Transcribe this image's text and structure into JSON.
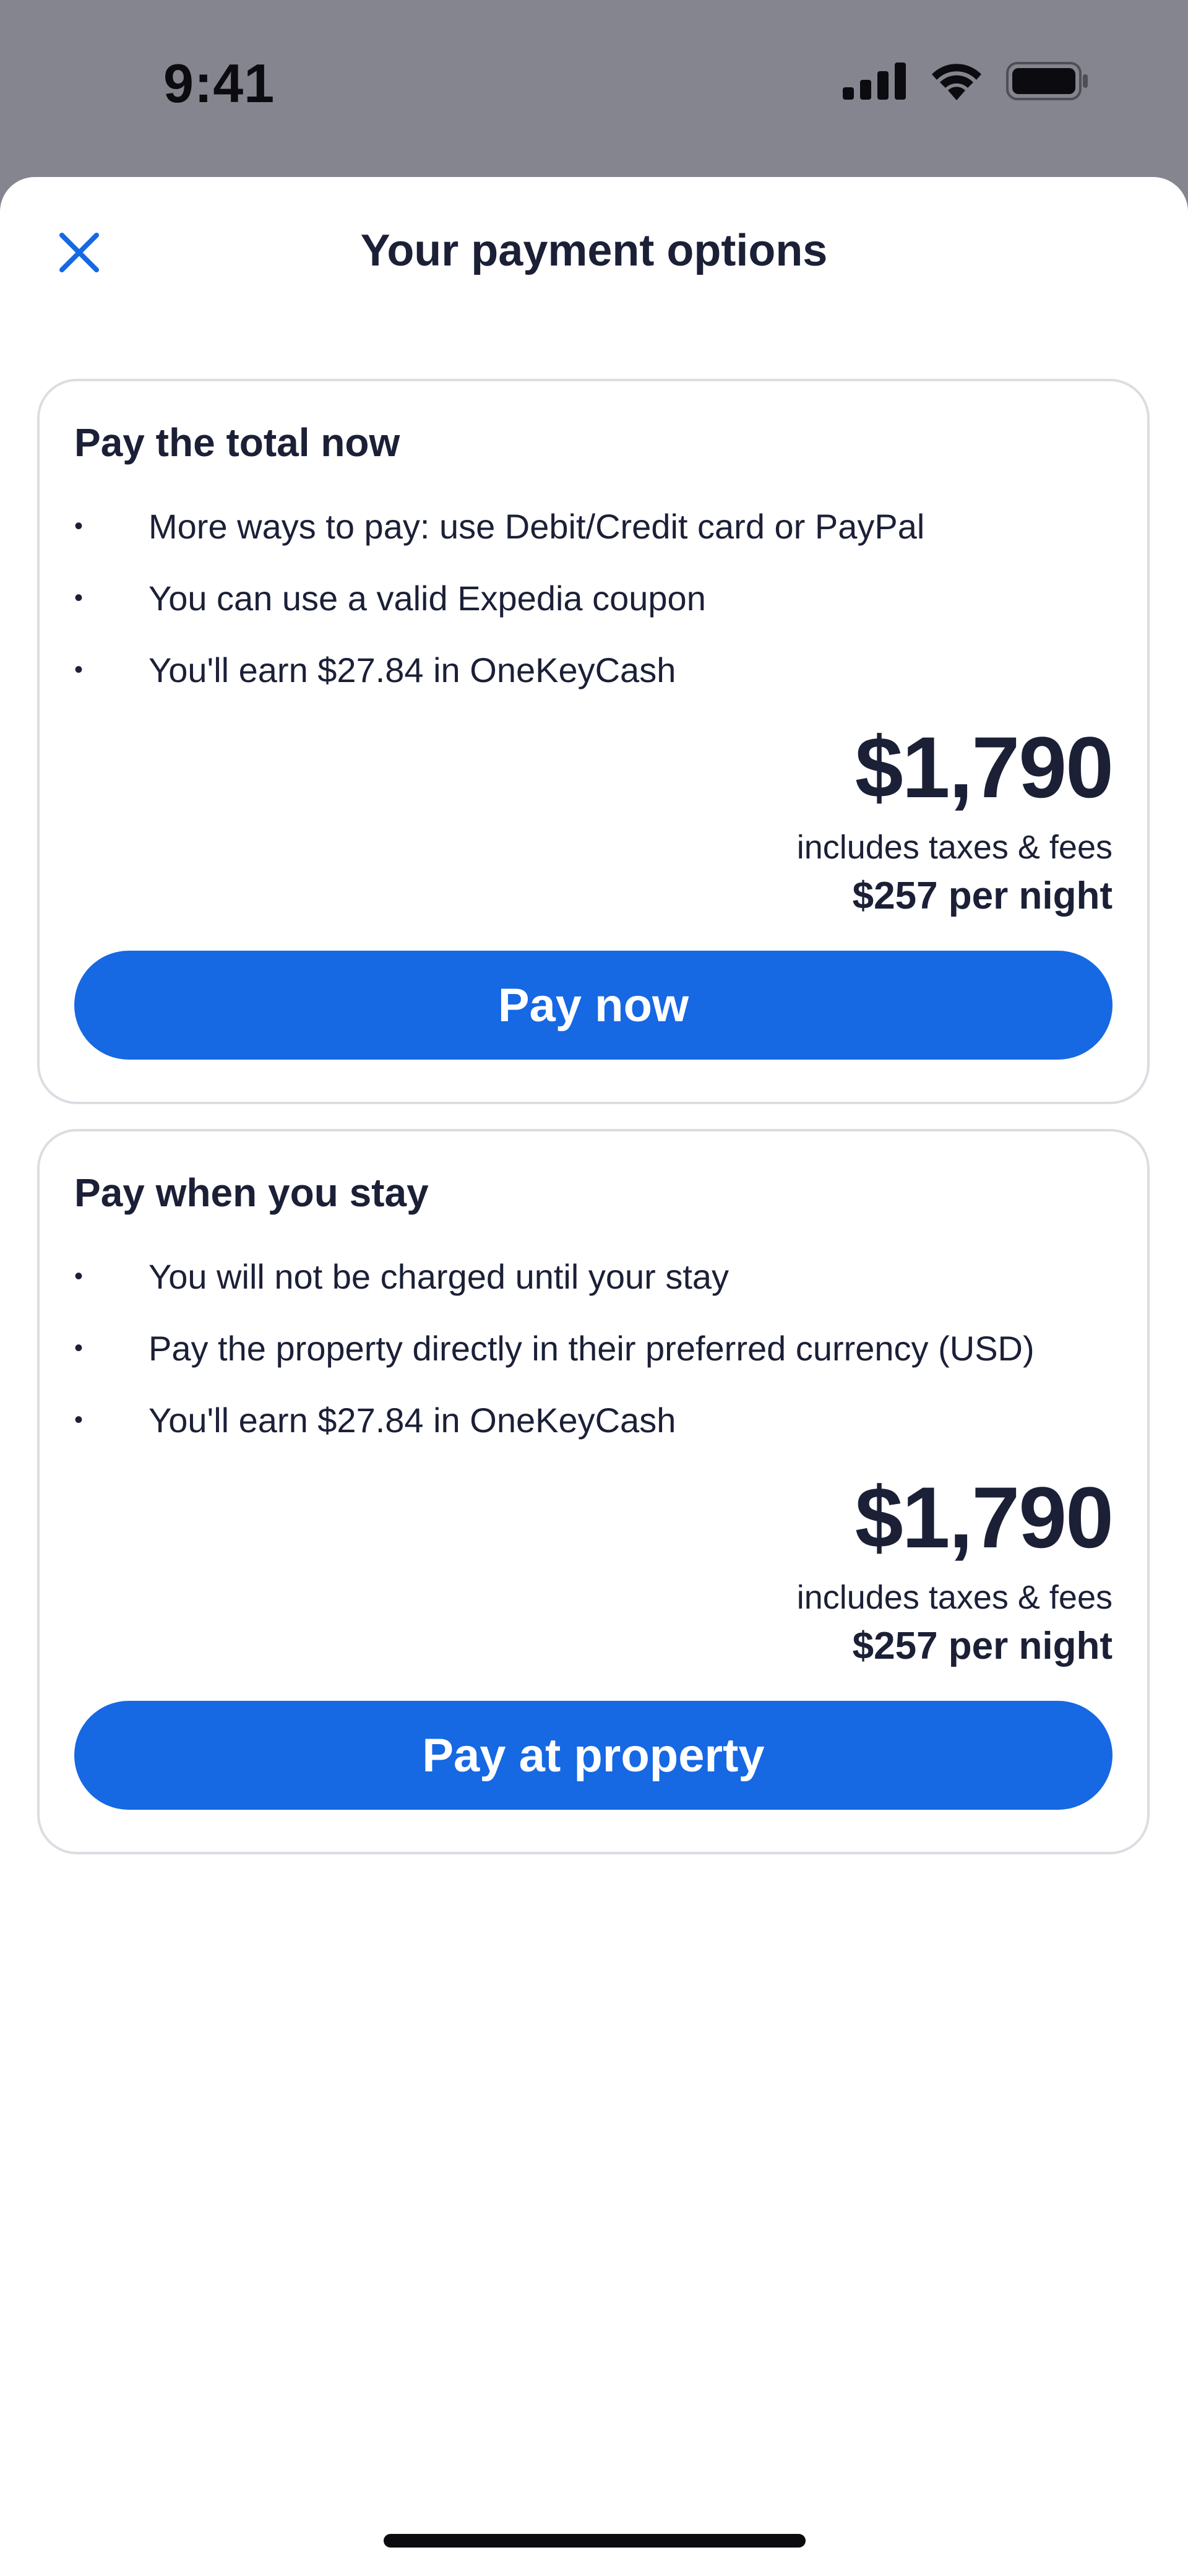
{
  "status_bar": {
    "time": "9:41",
    "icons": [
      "cellular-signal-icon",
      "wifi-icon",
      "battery-icon"
    ]
  },
  "sheet": {
    "title": "Your payment options",
    "close_icon": "close-icon"
  },
  "options": [
    {
      "title": "Pay the total now",
      "bullets": [
        "More ways to pay: use Debit/Credit card or PayPal",
        "You can use a valid Expedia coupon",
        "You'll earn $27.84 in OneKeyCash"
      ],
      "price": "$1,790",
      "price_note": "includes taxes & fees",
      "per_night": "$257 per night",
      "button_label": "Pay now"
    },
    {
      "title": "Pay when you stay",
      "bullets": [
        "You will not be charged until your stay",
        "Pay the property directly in their preferred currency (USD)",
        "You'll earn $27.84 in OneKeyCash"
      ],
      "price": "$1,790",
      "price_note": "includes taxes & fees",
      "per_night": "$257 per night",
      "button_label": "Pay at property"
    }
  ],
  "bullet_glyph": "•",
  "colors": {
    "accent": "#1668e3",
    "text": "#1b2037",
    "backdrop": "#85858f",
    "card_border": "#dcdde2"
  }
}
